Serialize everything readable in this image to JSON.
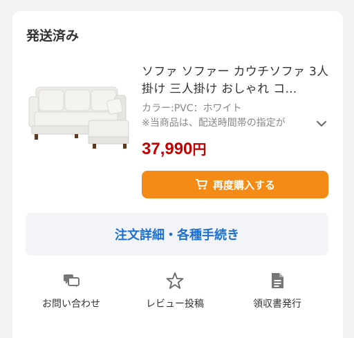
{
  "order": {
    "status": "発送済み"
  },
  "product": {
    "title": "ソファ ソファー カウチソファ 3人掛け 三人掛け おしゃれ コ…",
    "option": "カラー:PVC：ホワイト",
    "note": "※当商品は、配送時間帯の指定が",
    "price": "37,990",
    "price_suffix": "円",
    "image_icon": "sofa-image"
  },
  "buttons": {
    "rebuy_label": "再度購入する",
    "rebuy_icon": "cart-icon",
    "details_label": "注文詳細・各種手続き"
  },
  "actions": [
    {
      "label": "お問い合わせ",
      "icon": "chat-icon"
    },
    {
      "label": "レビュー投稿",
      "icon": "star-icon"
    },
    {
      "label": "領収書発行",
      "icon": "document-icon"
    }
  ],
  "colors": {
    "accent_orange": "#f48b16",
    "price_red": "#bf0000",
    "link_blue": "#1c6fd1"
  }
}
